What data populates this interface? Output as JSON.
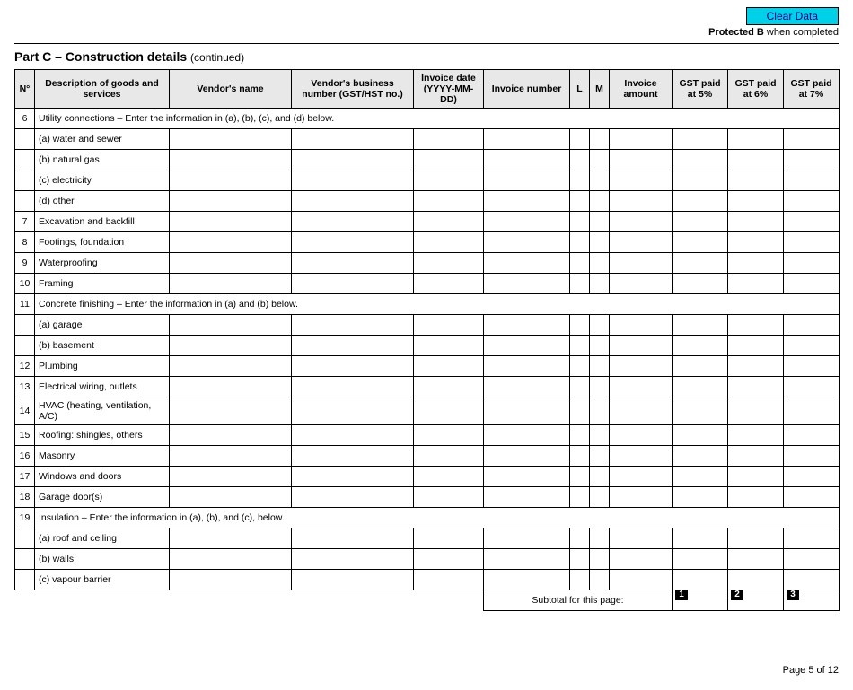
{
  "buttons": {
    "clear": "Clear Data"
  },
  "header": {
    "protected_label_bold": "Protected B",
    "protected_label_rest": " when completed",
    "part_main": "Part C – Construction details",
    "part_cont": "(continued)"
  },
  "columns": {
    "no": "N°",
    "desc": "Description of goods and services",
    "vendor": "Vendor's name",
    "bn": "Vendor's business number (GST/HST no.)",
    "date": "Invoice date (YYYY-MM-DD)",
    "invno": "Invoice number",
    "l": "L",
    "m": "M",
    "amt": "Invoice amount",
    "gst5": "GST paid at 5%",
    "gst6": "GST paid at 6%",
    "gst7": "GST paid at 7%"
  },
  "rows": {
    "r6": {
      "no": "6",
      "desc": "Utility connections – Enter the information in (a), (b), (c), and (d) below."
    },
    "r6a": {
      "desc": "(a) water and sewer"
    },
    "r6b": {
      "desc": "(b) natural gas"
    },
    "r6c": {
      "desc": "(c) electricity"
    },
    "r6d": {
      "desc": "(d) other"
    },
    "r7": {
      "no": "7",
      "desc": "Excavation and backfill"
    },
    "r8": {
      "no": "8",
      "desc": "Footings, foundation"
    },
    "r9": {
      "no": "9",
      "desc": "Waterproofing"
    },
    "r10": {
      "no": "10",
      "desc": "Framing"
    },
    "r11": {
      "no": "11",
      "desc": "Concrete finishing – Enter the information in (a) and (b) below."
    },
    "r11a": {
      "desc": "(a) garage"
    },
    "r11b": {
      "desc": "(b) basement"
    },
    "r12": {
      "no": "12",
      "desc": "Plumbing"
    },
    "r13": {
      "no": "13",
      "desc": "Electrical wiring, outlets"
    },
    "r14": {
      "no": "14",
      "desc": "HVAC (heating, ventilation, A/C)"
    },
    "r15": {
      "no": "15",
      "desc": "Roofing: shingles, others"
    },
    "r16": {
      "no": "16",
      "desc": "Masonry"
    },
    "r17": {
      "no": "17",
      "desc": "Windows and doors"
    },
    "r18": {
      "no": "18",
      "desc": "Garage door(s)"
    },
    "r19": {
      "no": "19",
      "desc": "Insulation – Enter the information in (a), (b), and (c), below."
    },
    "r19a": {
      "desc": "(a) roof and ceiling"
    },
    "r19b": {
      "desc": "(b) walls"
    },
    "r19c": {
      "desc": "(c) vapour barrier"
    }
  },
  "subtotal": {
    "label": "Subtotal for this page:",
    "box1": "1",
    "box2": "2",
    "box3": "3"
  },
  "footer": {
    "page": "Page 5 of 12"
  }
}
